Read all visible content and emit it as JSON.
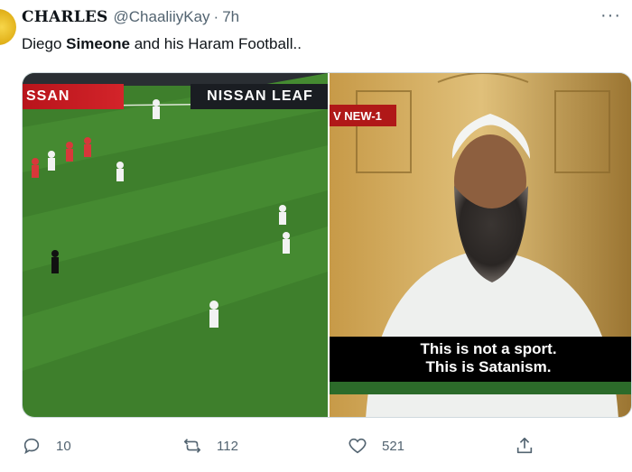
{
  "tweet": {
    "display_name": "CHARLES",
    "handle": "@ChaaliiyKay",
    "separator": "·",
    "time": "7h",
    "more_icon": "more-dots-icon",
    "text_before": "Diego ",
    "text_bold": "Simeone",
    "text_after": " and his Haram Football.."
  },
  "media": {
    "left_image": {
      "board_left": "SSAN",
      "board_right": "NISSAN LEAF"
    },
    "right_image": {
      "channel_logo": "V NEW-1",
      "caption_line1": "This is not a sport.",
      "caption_line2": "This is Satanism."
    }
  },
  "actions": {
    "reply": {
      "icon": "reply-icon",
      "count": "10"
    },
    "retweet": {
      "icon": "retweet-icon",
      "count": "112"
    },
    "like": {
      "icon": "heart-icon",
      "count": "521"
    },
    "share": {
      "icon": "share-icon"
    }
  },
  "colors": {
    "text": "#0f1419",
    "secondary": "#536471",
    "pitch_green": "#3d7d2a",
    "caption_bar": "#000000"
  }
}
